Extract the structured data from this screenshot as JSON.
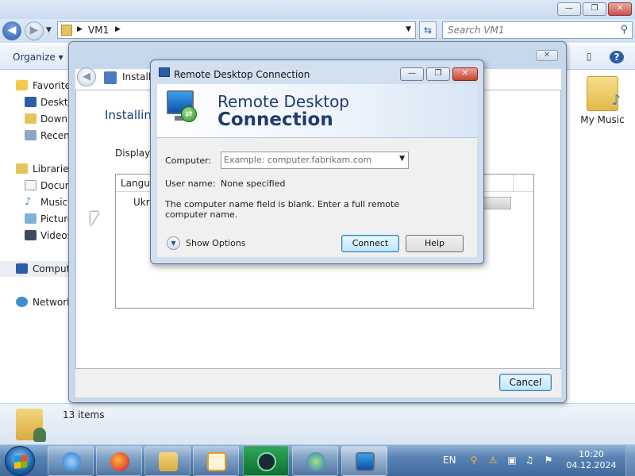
{
  "explorer": {
    "breadcrumb": [
      "VM1"
    ],
    "search_placeholder": "Search VM1",
    "organize_label": "Organize",
    "nav": {
      "favorites": "Favorites",
      "desktop": "Deskto",
      "downloads": "Downl",
      "recent": "Recent",
      "libraries": "Libraries",
      "documents": "Docum",
      "music": "Music",
      "pictures": "Picture",
      "videos": "Videos",
      "computer": "Comput",
      "network": "Network"
    },
    "folder_label": "My Music",
    "status_count": "13 items"
  },
  "install_dialog": {
    "title": "Install",
    "heading": "Installing",
    "display_label": "Display l",
    "column_header": "Langua",
    "row_text": "Ukra",
    "cancel_label": "Cancel"
  },
  "rdc_dialog": {
    "title": "Remote Desktop Connection",
    "banner_line1": "Remote Desktop",
    "banner_line2": "Connection",
    "computer_label": "Computer:",
    "computer_placeholder": "Example: computer.fabrikam.com",
    "computer_value": "",
    "username_label": "User name:",
    "username_value": "None specified",
    "message": "The computer name field is blank.  Enter a full remote computer name.",
    "show_options_label": "Show Options",
    "connect_label": "Connect",
    "help_label": "Help"
  },
  "taskbar": {
    "language": "EN",
    "time": "10:20",
    "date": "04.12.2024",
    "pinned": [
      "internet-explorer",
      "firefox",
      "file-explorer",
      "media-player",
      "app-green",
      "network-app",
      "remote-desktop"
    ]
  },
  "colors": {
    "accent": "#1f3b70",
    "taskbar": "#5883b3",
    "close_button": "#c7402e"
  }
}
